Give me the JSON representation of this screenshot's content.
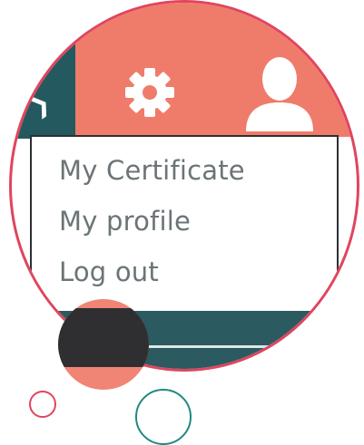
{
  "header": {
    "settings_icon": "gear-icon",
    "profile_icon": "user-icon",
    "nav_icon": "chevron-icon"
  },
  "menu": {
    "items": [
      {
        "label": "My Certificate"
      },
      {
        "label": "My profile"
      },
      {
        "label": "Log out"
      }
    ]
  },
  "colors": {
    "topbar": "#ef7b6a",
    "accent_dark": "#245a5f",
    "ring_pink": "#e0455e",
    "ring_teal": "#1f8a80"
  }
}
